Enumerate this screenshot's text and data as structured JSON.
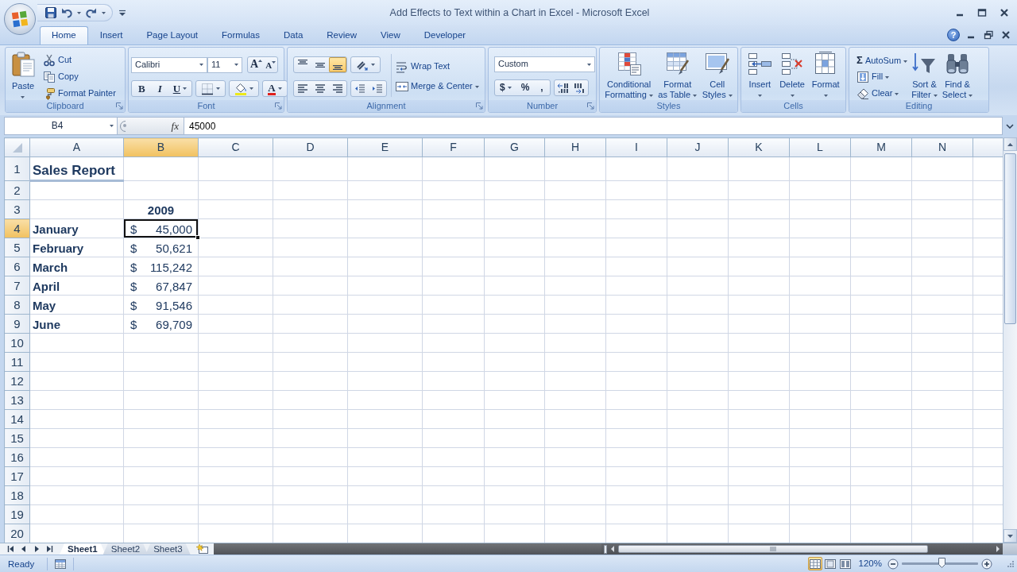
{
  "window": {
    "title": "Add Effects to Text within a Chart in Excel - Microsoft Excel"
  },
  "tab_bar": {
    "tabs": [
      {
        "label": "Home",
        "selected": true
      },
      {
        "label": "Insert",
        "selected": false
      },
      {
        "label": "Page Layout",
        "selected": false
      },
      {
        "label": "Formulas",
        "selected": false
      },
      {
        "label": "Data",
        "selected": false
      },
      {
        "label": "Review",
        "selected": false
      },
      {
        "label": "View",
        "selected": false
      },
      {
        "label": "Developer",
        "selected": false
      }
    ],
    "help": "?"
  },
  "ribbon_groups": [
    {
      "kind": "clipboard",
      "label": "Clipboard",
      "paste": "Paste",
      "actions": [
        "Cut",
        "Copy",
        "Format Painter"
      ]
    },
    {
      "kind": "font",
      "label": "Font",
      "font_name": "Calibri",
      "font_size": "11",
      "grow_font": "A",
      "shrink_font": "A",
      "bold": "B",
      "italic": "I",
      "underline": "U",
      "font_color": "A"
    },
    {
      "kind": "alignment",
      "label": "Alignment",
      "vertical_align": [
        {
          "selected": false
        },
        {
          "selected": false
        },
        {
          "selected": true
        }
      ],
      "wrap_text": "Wrap Text",
      "merge": "Merge & Center"
    },
    {
      "kind": "number",
      "label": "Number",
      "format": "Custom",
      "currency": "$",
      "percent": "%",
      "comma": ","
    },
    {
      "kind": "styles",
      "label": "Styles",
      "buttons": [
        [
          "Conditional",
          "Formatting"
        ],
        [
          "Format",
          "as Table"
        ],
        [
          "Cell",
          "Styles"
        ]
      ]
    },
    {
      "kind": "cells",
      "label": "Cells",
      "buttons": [
        "Insert",
        "Delete",
        "Format"
      ]
    },
    {
      "kind": "editing",
      "label": "Editing",
      "actions": [
        {
          "glyph": "Σ",
          "label": "AutoSum"
        },
        {
          "label": "Fill"
        },
        {
          "label": "Clear"
        }
      ],
      "buttons": [
        [
          "Sort &",
          "Filter"
        ],
        [
          "Find &",
          "Select"
        ]
      ]
    }
  ],
  "formula_bar": {
    "name_box": "B4",
    "function_button": "fx",
    "value": "45000"
  },
  "sheet": {
    "columns": [
      {
        "label": "A",
        "selected": false
      },
      {
        "label": "B",
        "selected": true
      },
      {
        "label": "C",
        "selected": false
      },
      {
        "label": "D",
        "selected": false
      },
      {
        "label": "E",
        "selected": false
      },
      {
        "label": "F",
        "selected": false
      },
      {
        "label": "G",
        "selected": false
      },
      {
        "label": "H",
        "selected": false
      },
      {
        "label": "I",
        "selected": false
      },
      {
        "label": "J",
        "selected": false
      },
      {
        "label": "K",
        "selected": false
      },
      {
        "label": "L",
        "selected": false
      },
      {
        "label": "M",
        "selected": false
      },
      {
        "label": "N",
        "selected": false
      }
    ],
    "rows": [
      {
        "label": "1",
        "selected": false,
        "column_a": {
          "kind": "title",
          "text": "Sales Report",
          "active": false
        }
      },
      {
        "label": "2",
        "selected": false
      },
      {
        "label": "3",
        "selected": false,
        "column_b": {
          "kind": "header",
          "text": "2009",
          "active": false
        }
      },
      {
        "label": "4",
        "selected": true,
        "column_a": {
          "kind": "label",
          "text": "January",
          "active": false
        },
        "column_b": {
          "kind": "currency",
          "symbol": "$",
          "amount": "45,000",
          "active": true
        }
      },
      {
        "label": "5",
        "selected": false,
        "column_a": {
          "kind": "label",
          "text": "February",
          "active": false
        },
        "column_b": {
          "kind": "currency",
          "symbol": "$",
          "amount": "50,621",
          "active": false
        }
      },
      {
        "label": "6",
        "selected": false,
        "column_a": {
          "kind": "label",
          "text": "March",
          "active": false
        },
        "column_b": {
          "kind": "currency",
          "symbol": "$",
          "amount": "115,242",
          "active": false
        }
      },
      {
        "label": "7",
        "selected": false,
        "column_a": {
          "kind": "label",
          "text": "April",
          "active": false
        },
        "column_b": {
          "kind": "currency",
          "symbol": "$",
          "amount": "67,847",
          "active": false
        }
      },
      {
        "label": "8",
        "selected": false,
        "column_a": {
          "kind": "label",
          "text": "May",
          "active": false
        },
        "column_b": {
          "kind": "currency",
          "symbol": "$",
          "amount": "91,546",
          "active": false
        }
      },
      {
        "label": "9",
        "selected": false,
        "column_a": {
          "kind": "label",
          "text": "June",
          "active": false
        },
        "column_b": {
          "kind": "currency",
          "symbol": "$",
          "amount": "69,709",
          "active": false
        }
      },
      {
        "label": "10",
        "selected": false
      },
      {
        "label": "11",
        "selected": false
      },
      {
        "label": "12",
        "selected": false
      },
      {
        "label": "13",
        "selected": false
      },
      {
        "label": "14",
        "selected": false
      },
      {
        "label": "15",
        "selected": false
      },
      {
        "label": "16",
        "selected": false
      },
      {
        "label": "17",
        "selected": false
      },
      {
        "label": "18",
        "selected": false
      },
      {
        "label": "19",
        "selected": false
      },
      {
        "label": "20",
        "selected": false
      }
    ]
  },
  "sheet_tabs": [
    {
      "label": "Sheet1",
      "selected": true
    },
    {
      "label": "Sheet2",
      "selected": false
    },
    {
      "label": "Sheet3",
      "selected": false
    }
  ],
  "status_bar": {
    "status": "Ready",
    "views": [
      {
        "selected": true
      },
      {
        "selected": false
      },
      {
        "selected": false
      }
    ],
    "zoom": "120%",
    "zoom_slider": {
      "level": 0.53
    }
  }
}
